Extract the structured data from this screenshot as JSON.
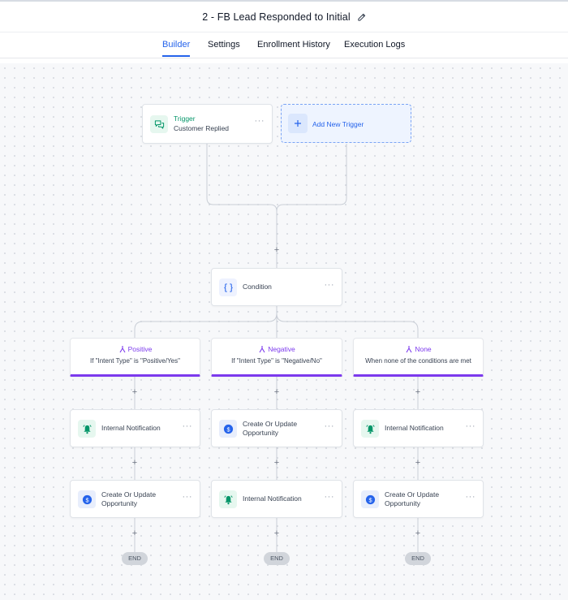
{
  "header": {
    "title": "2 - FB Lead Responded to Initial"
  },
  "tabs": [
    {
      "label": "Builder"
    },
    {
      "label": "Settings"
    },
    {
      "label": "Enrollment History"
    },
    {
      "label": "Execution Logs"
    }
  ],
  "trigger": {
    "title": "Trigger",
    "subtitle": "Customer Replied"
  },
  "add_trigger": {
    "label": "Add New Trigger"
  },
  "condition": {
    "label": "Condition"
  },
  "branches": [
    {
      "name": "Positive",
      "description": "If \"Intent Type\" is \"Positive/Yes\""
    },
    {
      "name": "Negative",
      "description": "If \"Intent Type\" is \"Negative/No\""
    },
    {
      "name": "None",
      "description": "When none of the conditions are met"
    }
  ],
  "actions": {
    "internal_notification": "Internal Notification",
    "create_update_opportunity_line1": "Create Or Update",
    "create_update_opportunity_line2": "Opportunity"
  },
  "menu_glyph": "···",
  "plus_glyph": "+",
  "end_label": "END",
  "colors": {
    "accent": "#2563eb",
    "branch": "#7c3aed",
    "trigger": "#059669"
  }
}
